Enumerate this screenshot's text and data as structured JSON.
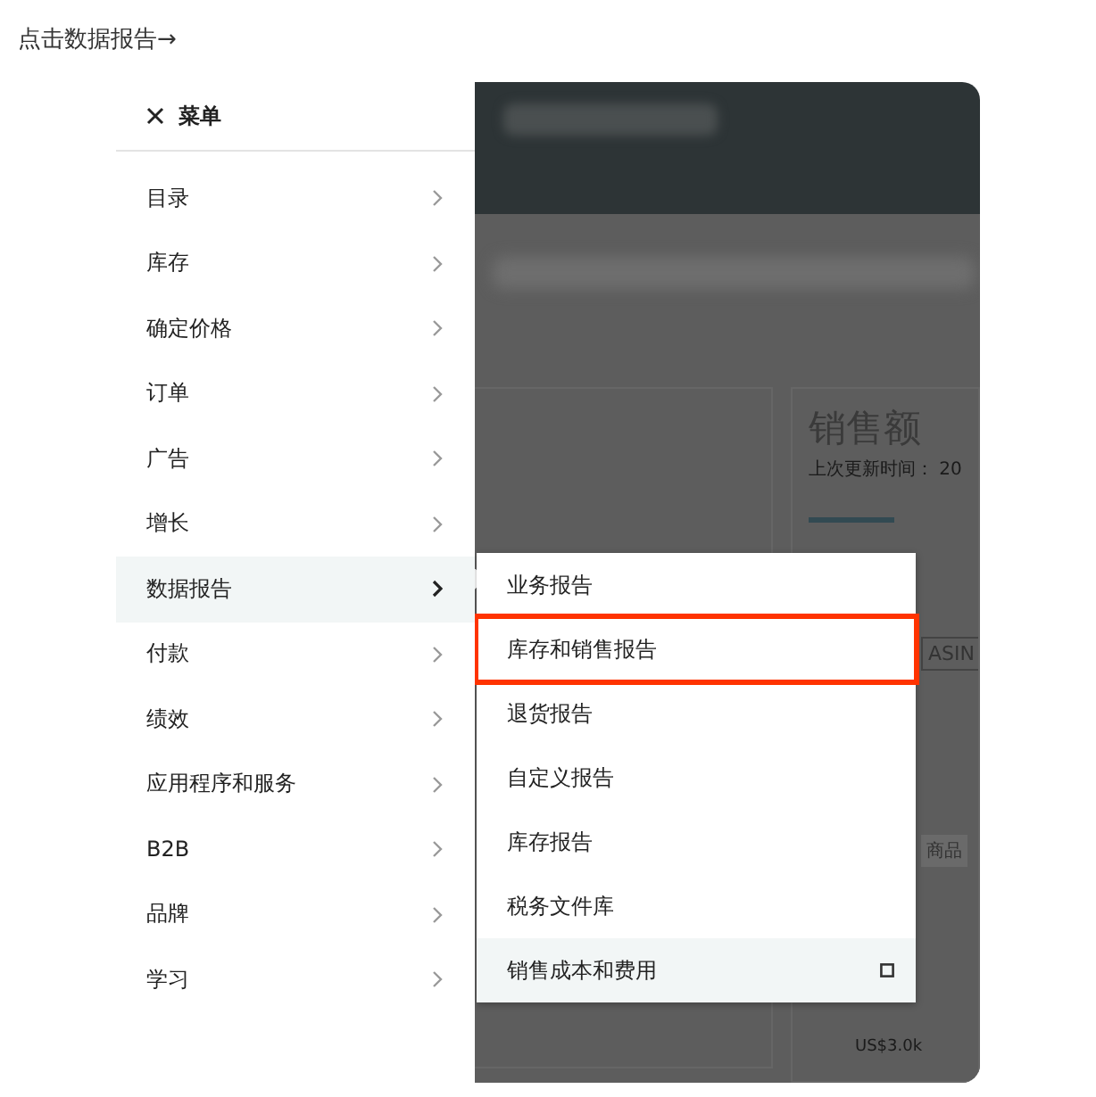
{
  "caption": "点击数据报告→",
  "menu": {
    "title": "菜单",
    "items": [
      {
        "label": "目录",
        "selected": false
      },
      {
        "label": "库存",
        "selected": false
      },
      {
        "label": "确定价格",
        "selected": false
      },
      {
        "label": "订单",
        "selected": false
      },
      {
        "label": "广告",
        "selected": false
      },
      {
        "label": "增长",
        "selected": false
      },
      {
        "label": "数据报告",
        "selected": true
      },
      {
        "label": "付款",
        "selected": false
      },
      {
        "label": "绩效",
        "selected": false
      },
      {
        "label": "应用程序和服务",
        "selected": false
      },
      {
        "label": "B2B",
        "selected": false
      },
      {
        "label": "品牌",
        "selected": false
      },
      {
        "label": "学习",
        "selected": false
      }
    ]
  },
  "submenu": {
    "items": [
      {
        "label": "业务报告",
        "marked": false,
        "hovered": false,
        "bookmark": false
      },
      {
        "label": "库存和销售报告",
        "marked": true,
        "hovered": false,
        "bookmark": false
      },
      {
        "label": "退货报告",
        "marked": false,
        "hovered": false,
        "bookmark": false
      },
      {
        "label": "自定义报告",
        "marked": false,
        "hovered": false,
        "bookmark": false
      },
      {
        "label": "库存报告",
        "marked": false,
        "hovered": false,
        "bookmark": false
      },
      {
        "label": "税务文件库",
        "marked": false,
        "hovered": false,
        "bookmark": false
      },
      {
        "label": "销售成本和费用",
        "marked": false,
        "hovered": true,
        "bookmark": true
      }
    ]
  },
  "background_page": {
    "heading": "销售额",
    "updated": "上次更新时间：  20",
    "button": "ASIN",
    "tab": "商品",
    "axis_label": "US$3.0k"
  }
}
